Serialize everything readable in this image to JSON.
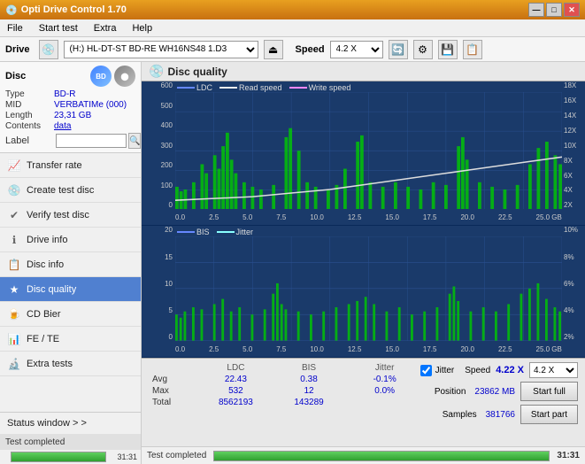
{
  "app": {
    "title": "Opti Drive Control 1.70",
    "icon": "💿"
  },
  "titlebar": {
    "title": "Opti Drive Control 1.70",
    "minimize": "—",
    "maximize": "□",
    "close": "✕"
  },
  "menu": {
    "items": [
      "File",
      "Start test",
      "Extra",
      "Help"
    ]
  },
  "drivebar": {
    "drive_label": "Drive",
    "drive_value": "(H:)  HL-DT-ST BD-RE  WH16NS48 1.D3",
    "speed_label": "Speed",
    "speed_value": "4.2 X"
  },
  "disc": {
    "header": "Disc",
    "type_label": "Type",
    "type_value": "BD-R",
    "mid_label": "MID",
    "mid_value": "VERBATIMe (000)",
    "length_label": "Length",
    "length_value": "23,31 GB",
    "contents_label": "Contents",
    "contents_value": "data",
    "label_label": "Label",
    "label_value": ""
  },
  "nav": {
    "items": [
      {
        "id": "transfer-rate",
        "label": "Transfer rate",
        "icon": "📈"
      },
      {
        "id": "create-test-disc",
        "label": "Create test disc",
        "icon": "💿"
      },
      {
        "id": "verify-test-disc",
        "label": "Verify test disc",
        "icon": "✔"
      },
      {
        "id": "drive-info",
        "label": "Drive info",
        "icon": "ℹ"
      },
      {
        "id": "disc-info",
        "label": "Disc info",
        "icon": "📋"
      },
      {
        "id": "disc-quality",
        "label": "Disc quality",
        "icon": "★",
        "active": true
      },
      {
        "id": "cd-bier",
        "label": "CD Bier",
        "icon": "🍺"
      },
      {
        "id": "fe-te",
        "label": "FE / TE",
        "icon": "📊"
      },
      {
        "id": "extra-tests",
        "label": "Extra tests",
        "icon": "🔬"
      }
    ]
  },
  "status_window": {
    "label": "Status window > >"
  },
  "status_bar": {
    "text": "Test completed",
    "progress_percent": 100,
    "time": "31:31"
  },
  "disc_quality": {
    "title": "Disc quality",
    "icon": "★"
  },
  "chart1": {
    "title": "LDC / Read speed / Write speed",
    "legend": {
      "ldc": "LDC",
      "read": "Read speed",
      "write": "Write speed"
    },
    "y_left": [
      "600",
      "500",
      "400",
      "300",
      "200",
      "100",
      "0"
    ],
    "y_right": [
      "18X",
      "16X",
      "14X",
      "12X",
      "10X",
      "8X",
      "6X",
      "4X",
      "2X"
    ],
    "x_labels": [
      "0.0",
      "2.5",
      "5.0",
      "7.5",
      "10.0",
      "12.5",
      "15.0",
      "17.5",
      "20.0",
      "22.5",
      "25.0"
    ],
    "x_unit": "GB"
  },
  "chart2": {
    "title": "BIS / Jitter",
    "legend": {
      "bis": "BIS",
      "jitter": "Jitter"
    },
    "y_left": [
      "20",
      "15",
      "10",
      "5",
      "0"
    ],
    "y_right": [
      "10%",
      "8%",
      "6%",
      "4%",
      "2%"
    ],
    "x_labels": [
      "0.0",
      "2.5",
      "5.0",
      "7.5",
      "10.0",
      "12.5",
      "15.0",
      "17.5",
      "20.0",
      "22.5",
      "25.0"
    ],
    "x_unit": "GB"
  },
  "stats": {
    "headers": [
      "",
      "LDC",
      "BIS",
      "",
      "Jitter",
      "Speed",
      ""
    ],
    "avg_label": "Avg",
    "avg_ldc": "22.43",
    "avg_bis": "0.38",
    "avg_jitter": "-0.1%",
    "max_label": "Max",
    "max_ldc": "532",
    "max_bis": "12",
    "max_jitter": "0.0%",
    "total_label": "Total",
    "total_ldc": "8562193",
    "total_bis": "143289",
    "jitter_checked": true,
    "jitter_label": "Jitter",
    "speed_value": "4.22 X",
    "speed_select": "4.2 X",
    "position_label": "Position",
    "position_value": "23862 MB",
    "samples_label": "Samples",
    "samples_value": "381766",
    "start_full": "Start full",
    "start_part": "Start part"
  }
}
